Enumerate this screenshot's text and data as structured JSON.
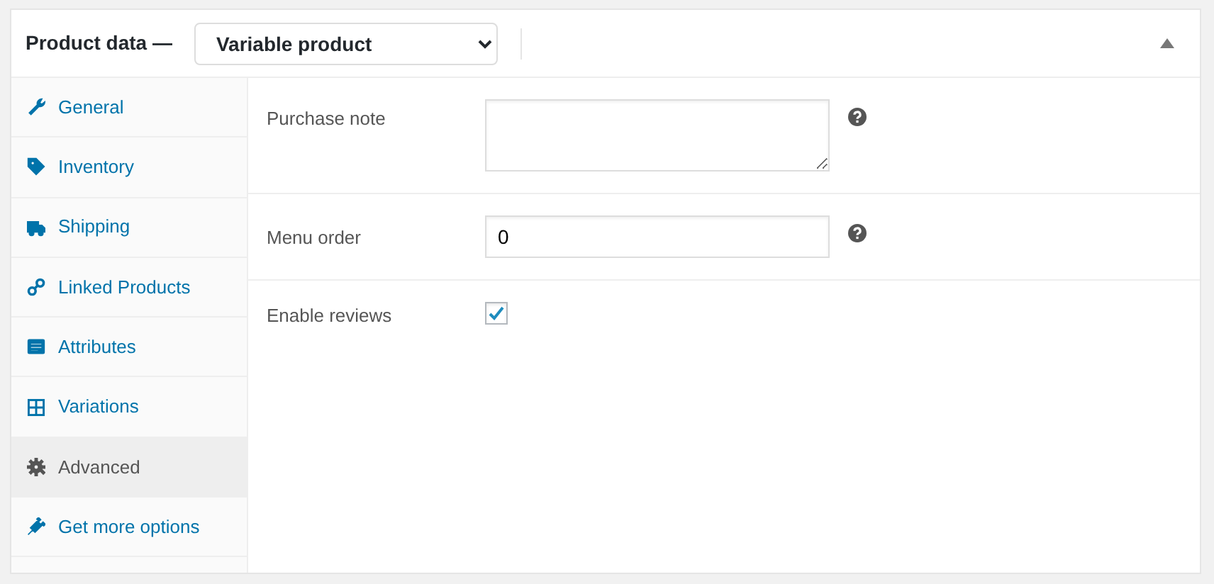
{
  "panel": {
    "title": "Product data —",
    "product_type": "Variable product",
    "collapsed": false
  },
  "tabs": [
    {
      "label": "General",
      "selected": false
    },
    {
      "label": "Inventory",
      "selected": false
    },
    {
      "label": "Shipping",
      "selected": false
    },
    {
      "label": "Linked Products",
      "selected": false
    },
    {
      "label": "Attributes",
      "selected": false
    },
    {
      "label": "Variations",
      "selected": false
    },
    {
      "label": "Advanced",
      "selected": true
    },
    {
      "label": "Get more options",
      "selected": false
    }
  ],
  "fields": [
    {
      "kind": "textarea",
      "label": "Purchase note",
      "help": true
    },
    {
      "kind": "number",
      "label": "Menu order",
      "value": "0",
      "help": true
    },
    {
      "kind": "checkbox",
      "label": "Enable reviews",
      "checked": true,
      "help": false
    }
  ]
}
